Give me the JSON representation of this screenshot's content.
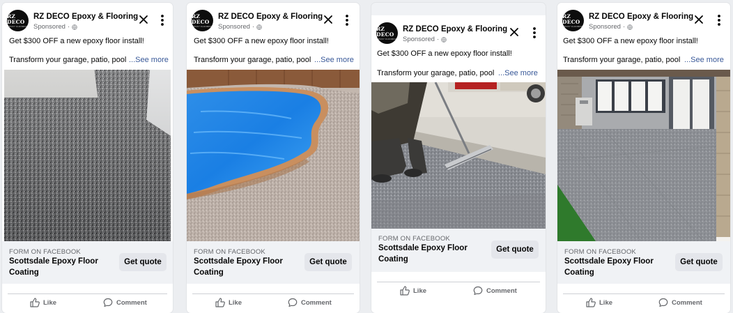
{
  "ads": [
    {
      "page_name": "RZ DECO Epoxy & Flooring",
      "avatar_line1": "RZ DECO",
      "avatar_line2": "EPOXY FLOORING",
      "sponsored": "Sponsored",
      "primary_text": "Get $300 OFF a new epoxy floor install!",
      "secondary_text": "Transform your garage, patio, pool",
      "see_more": "...See more",
      "cta_source": "FORM ON FACEBOOK",
      "cta_headline": "Scottsdale Epoxy Floor Coating",
      "cta_button": "Get quote",
      "like_label": "Like",
      "comment_label": "Comment",
      "image": "flake-floor-corner"
    },
    {
      "page_name": "RZ DECO Epoxy & Flooring",
      "avatar_line1": "RZ DECO",
      "avatar_line2": "EPOXY FLOORING",
      "sponsored": "Sponsored",
      "primary_text": "Get $300 OFF a new epoxy floor install!",
      "secondary_text": "Transform your garage, patio, pool",
      "see_more": "...See more",
      "cta_source": "FORM ON FACEBOOK",
      "cta_headline": "Scottsdale Epoxy Floor Coating",
      "cta_button": "Get quote",
      "like_label": "Like",
      "comment_label": "Comment",
      "image": "pool-deck"
    },
    {
      "page_name": "RZ DECO Epoxy & Flooring",
      "avatar_line1": "RZ DECO",
      "avatar_line2": "EPOXY FLOORING",
      "sponsored": "Sponsored",
      "primary_text": "Get $300 OFF a new epoxy floor install!",
      "secondary_text": "Transform your garage, patio, pool",
      "see_more": "...See more",
      "cta_source": "FORM ON FACEBOOK",
      "cta_headline": "Scottsdale Epoxy Floor Coating",
      "cta_button": "Get quote",
      "like_label": "Like",
      "comment_label": "Comment",
      "image": "squeegee-worker"
    },
    {
      "page_name": "RZ DECO Epoxy & Flooring",
      "avatar_line1": "RZ DECO",
      "avatar_line2": "EPOXY FLOORING",
      "sponsored": "Sponsored",
      "primary_text": "Get $300 OFF a new epoxy floor install!",
      "secondary_text": "Transform your garage, patio, pool",
      "see_more": "...See more",
      "cta_source": "FORM ON FACEBOOK",
      "cta_headline": "Scottsdale Epoxy Floor Coating",
      "cta_button": "Get quote",
      "like_label": "Like",
      "comment_label": "Comment",
      "image": "patio-flake"
    }
  ],
  "colors": {
    "background": "#eceef1",
    "card": "#ffffff",
    "cta_bar": "#f0f2f5",
    "cta_button": "#e4e6eb",
    "link": "#385898",
    "muted_text": "#65676b",
    "text": "#050505"
  },
  "icons": [
    "globe-icon",
    "close-icon",
    "more-options-icon",
    "like-icon",
    "comment-icon"
  ]
}
